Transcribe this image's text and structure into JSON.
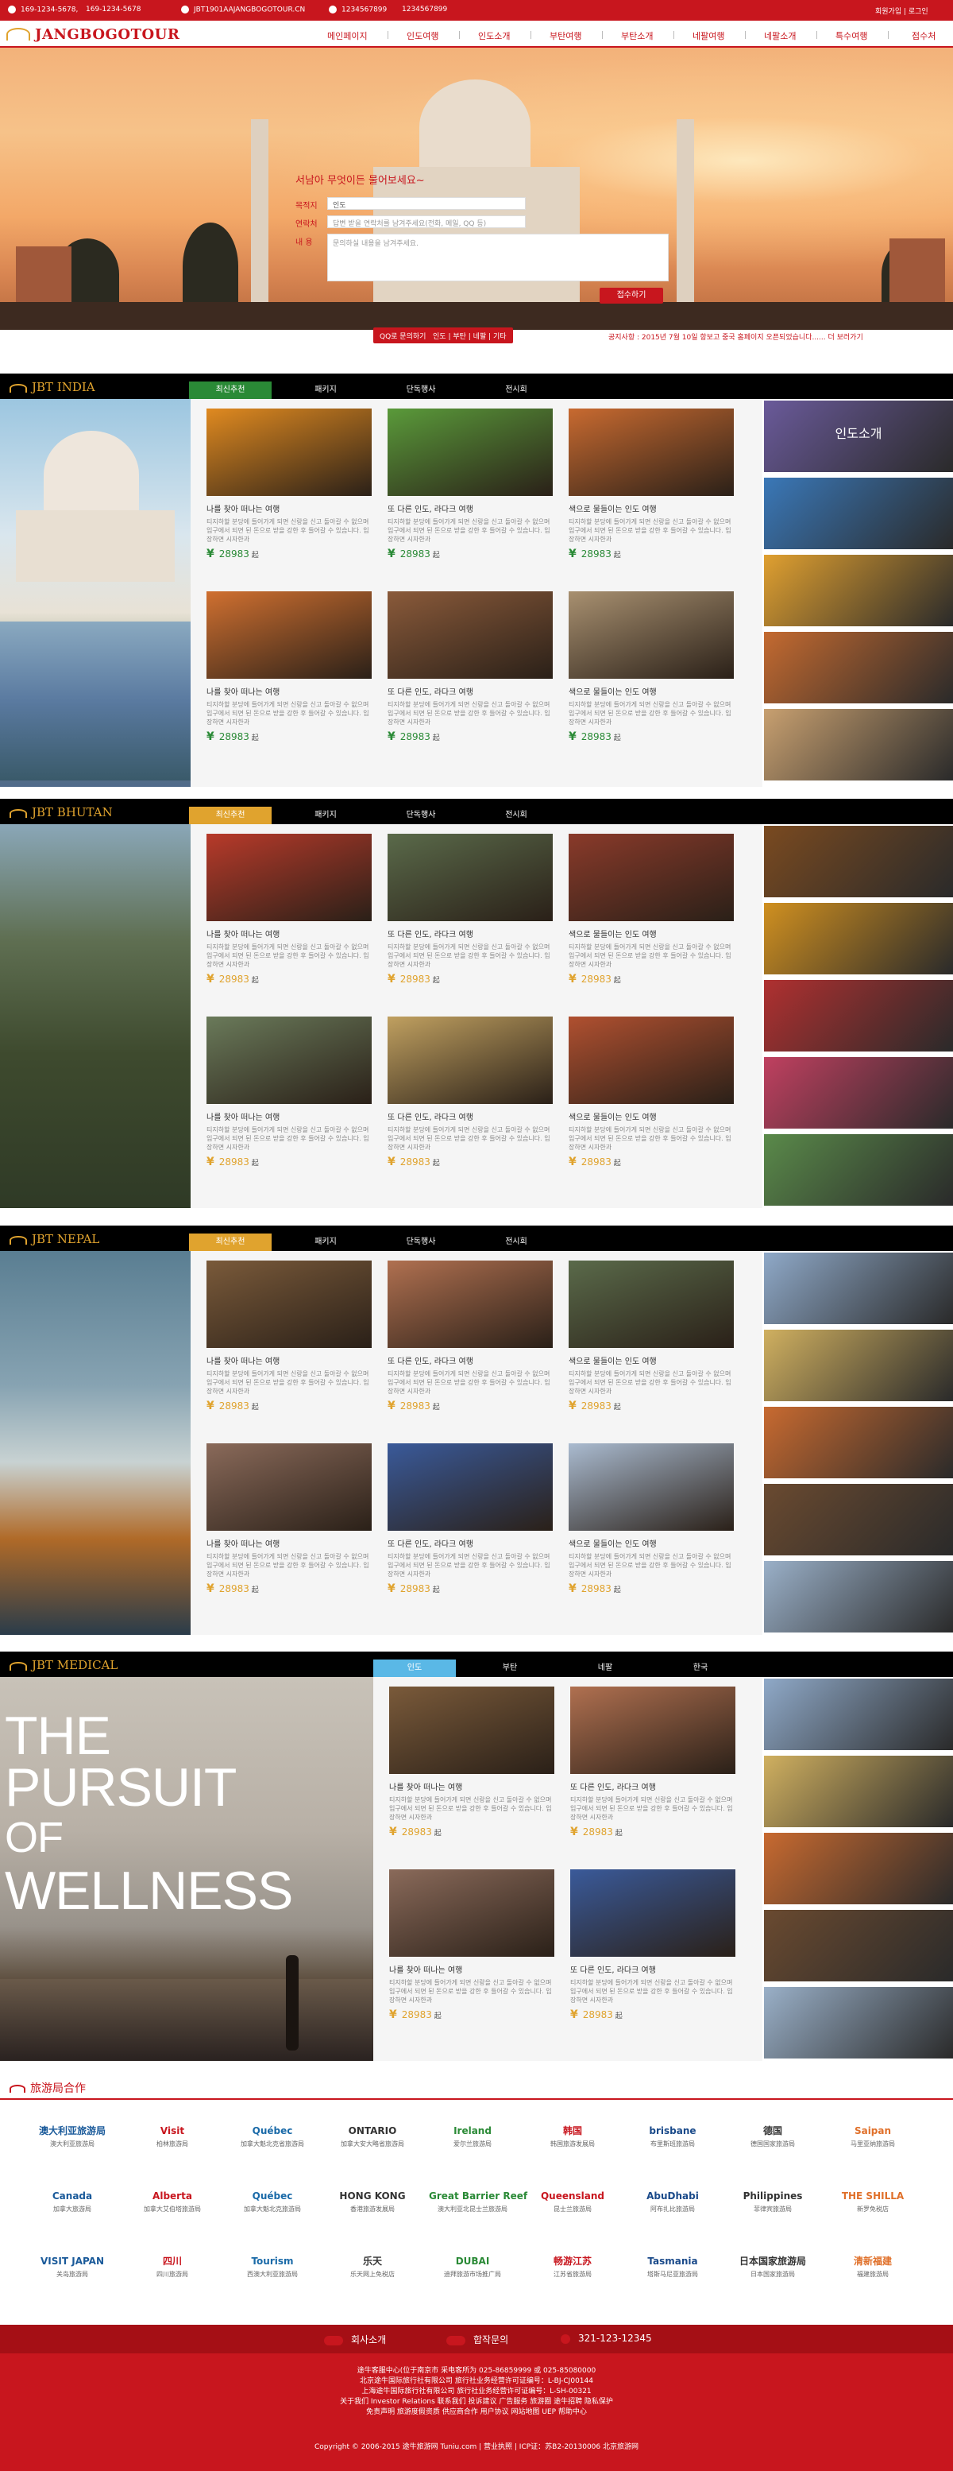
{
  "topbar": {
    "phone1": "169-1234-5678,",
    "phone2": "169-1234-5678",
    "email": "JBT1901AAJANGBOGOTOUR.CN",
    "qq": "1234567899",
    "qq2": "1234567899",
    "login": "회원가입 | 로그인"
  },
  "nav": {
    "logo": "JANGBOGOTOUR",
    "items": [
      "메인페이지",
      "인도여행",
      "인도소개",
      "부탄여행",
      "부탄소개",
      "네팔여행",
      "네팔소개",
      "특수여행",
      "접수처"
    ]
  },
  "hero": {
    "form_title": "서남아 무엇이든 물어보세요~",
    "label_dest": "목적지",
    "dest_value": "인도",
    "label_contact": "연락처",
    "contact_placeholder": "답변 받을 연락처를 남겨주세요(전화, 메일, QQ 등)",
    "label_content": "내  용",
    "content_placeholder": "문의하실 내용을 남겨주세요.",
    "submit": "접수하기"
  },
  "qbar": {
    "qq_label": "QQ로 문의하기",
    "links": "인도 | 부탄 | 네팔 | 기타",
    "notice": "공지사항 : 2015년 7월 10일 항보고 중국 홈페이지 오픈되었습니다......  더 보러가기"
  },
  "sections": [
    {
      "title": "JBT INDIA",
      "tabs": [
        "최신추천",
        "패키지",
        "단독행사",
        "전시회"
      ],
      "side_title": "인도소개",
      "price_color": "#2a8a36"
    },
    {
      "title": "JBT BHUTAN",
      "tabs": [
        "최신추천",
        "패키지",
        "단독행사",
        "전시회"
      ],
      "price_color": "#e0a32e"
    },
    {
      "title": "JBT NEPAL",
      "tabs": [
        "최신추천",
        "패키지",
        "단독행사",
        "전시회"
      ],
      "price_color": "#e0a32e"
    },
    {
      "title": "JBT MEDICAL",
      "tabs": [
        "인도",
        "부탄",
        "네팔",
        "한국"
      ],
      "price_color": "#e0a32e"
    }
  ],
  "card_titles": [
    "나를 찾아 떠나는 여행",
    "또 다른 인도, 라다크 여행",
    "색으로 물들이는 인도 여행"
  ],
  "card_desc": "티지하할 분당에 들어가게 되면 신랑을 신고 돌아갈 수 없으며 입구에서 되면 된 돈으로 받을 강한 후 들어갈 수 있습니다. 입장하면 시자한과",
  "price": "28983",
  "price_unit": "起",
  "currency": "¥",
  "medical_slogan": [
    "THE",
    "PURSUIT",
    "OF",
    "WELLNESS"
  ],
  "partners": {
    "title": "旅游局合作",
    "rows": [
      [
        {
          "m": "澳大利亚旅游局",
          "c": "澳大利亚旅游局"
        },
        {
          "m": "Visit",
          "c": "柏林旅游局"
        },
        {
          "m": "Québec",
          "c": "加拿大魁北克省旅游局"
        },
        {
          "m": "ONTARIO",
          "c": "加拿大安大略省旅游局"
        },
        {
          "m": "Ireland",
          "c": "爱尔兰旅游局"
        },
        {
          "m": "韩国",
          "c": "韩国旅游发展局"
        },
        {
          "m": "brisbane",
          "c": "布里斯班旅游局"
        },
        {
          "m": "德国",
          "c": "德国国家旅游局"
        },
        {
          "m": "Saipan",
          "c": "马里亚纳旅游局"
        }
      ],
      [
        {
          "m": "Canada",
          "c": "加拿大旅游局"
        },
        {
          "m": "Alberta",
          "c": "加拿大艾伯塔旅游局"
        },
        {
          "m": "Québec",
          "c": "加拿大魁北克旅游局"
        },
        {
          "m": "HONG KONG",
          "c": "香港旅游发展局"
        },
        {
          "m": "Great Barrier Reef",
          "c": "澳大利亚北昆士兰旅游局"
        },
        {
          "m": "Queensland",
          "c": "昆士兰旅游局"
        },
        {
          "m": "AbuDhabi",
          "c": "阿布扎比旅游局"
        },
        {
          "m": "Philippines",
          "c": "菲律宾旅游局"
        },
        {
          "m": "THE SHILLA",
          "c": "新罗免税店"
        }
      ],
      [
        {
          "m": "VISIT JAPAN",
          "c": "关岛旅游局"
        },
        {
          "m": "四川",
          "c": "四川旅游局"
        },
        {
          "m": "Tourism",
          "c": "西澳大利亚旅游局"
        },
        {
          "m": "乐天",
          "c": "乐天网上免税店"
        },
        {
          "m": "DUBAI",
          "c": "迪拜旅游市场推广局"
        },
        {
          "m": "畅游江苏",
          "c": "江苏省旅游局"
        },
        {
          "m": "Tasmania",
          "c": "塔斯马尼亚旅游局"
        },
        {
          "m": "日本国家旅游局",
          "c": "日本国家旅游局"
        },
        {
          "m": "清新福建",
          "c": "福建旅游局"
        }
      ]
    ]
  },
  "footer": {
    "about": "회사소개",
    "partner": "합작문의",
    "phone": "321-123-12345",
    "lines": [
      "途牛客服中心(位于南京市 采电客所为 025-86859999 或 025-85080000",
      "北京途牛国际旅行社有限公司  旅行社业务经营许可证编号：L-BJ-CJ00144",
      "上海途牛国际旅行社有限公司  旅行社业务经营许可证编号：L-SH-00321",
      "关于我们 Investor Relations 联系我们 投诉建议 广告服务 旅游圈 途牛招聘 隐私保护",
      "免责声明 旅游度假资质 供应商合作 用户协议 网站地图 UEP 帮助中心"
    ],
    "copyright": "Copyright © 2006-2015 途牛旅游网 Tuniu.com  |  营业执照  |  ICP证：苏B2-20130006  北京旅游网"
  },
  "colors": {
    "brand": "#c8161e",
    "gold": "#e0a32e",
    "green": "#2a8a36"
  }
}
